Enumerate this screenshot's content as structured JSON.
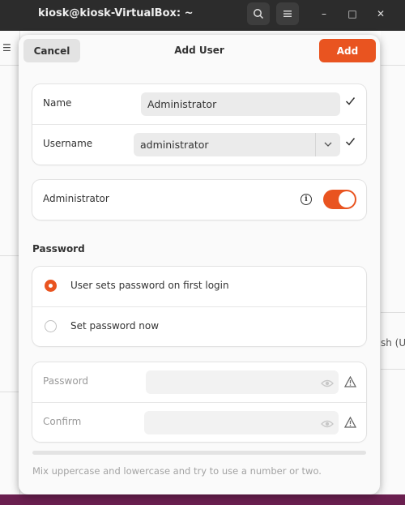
{
  "window": {
    "title": "kiosk@kiosk-VirtualBox: ~",
    "search_icon": "search-icon",
    "menu_icon": "hamburger-icon",
    "minimize_glyph": "–",
    "maximize_glyph": "□",
    "close_glyph": "✕"
  },
  "background": {
    "hamburger_glyph": "☰",
    "truncated_text": "sh (Ur"
  },
  "dialog": {
    "title": "Add User",
    "cancel_label": "Cancel",
    "add_label": "Add",
    "name": {
      "label": "Name",
      "value": "Administrator"
    },
    "username": {
      "label": "Username",
      "value": "administrator"
    },
    "admin": {
      "label": "Administrator",
      "enabled": true
    },
    "password_section": {
      "title": "Password",
      "options": [
        {
          "label": "User sets password on first login",
          "selected": true
        },
        {
          "label": "Set password now",
          "selected": false
        }
      ]
    },
    "password_field": {
      "label": "Password",
      "value": ""
    },
    "confirm_field": {
      "label": "Confirm",
      "value": ""
    },
    "hint": "Mix uppercase and lowercase and try to use a number or two."
  },
  "colors": {
    "accent": "#e95420",
    "titlebar": "#2c2c2c",
    "desktop": "#5a1b45"
  }
}
